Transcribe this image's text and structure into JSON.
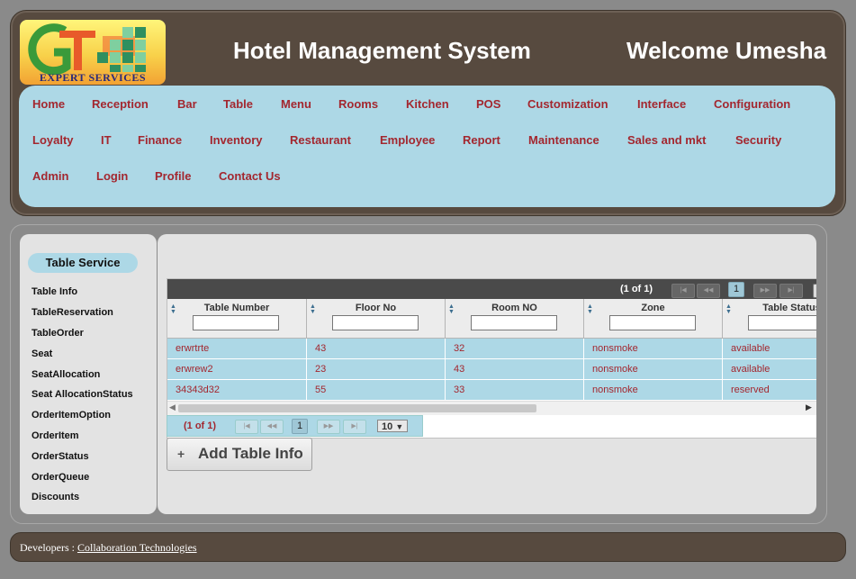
{
  "header": {
    "logo_text": "EXPERT SERVICES",
    "title": "Hotel Management System",
    "welcome": "Welcome Umesha"
  },
  "nav": {
    "items": [
      "Home",
      "Reception",
      "Bar",
      "Table",
      "Menu",
      "Rooms",
      "Kitchen",
      "POS",
      "Customization",
      "Interface",
      "Configuration",
      "Loyalty",
      "IT",
      "Finance",
      "Inventory",
      "Restaurant",
      "Employee",
      "Report",
      "Maintenance",
      "Sales and mkt",
      "Security",
      "Admin",
      "Login",
      "Profile",
      "Contact Us"
    ]
  },
  "sidebar": {
    "title": "Table Service",
    "items": [
      "Table Info",
      "TableReservation",
      "TableOrder",
      "Seat",
      "SeatAllocation",
      "Seat AllocationStatus",
      "OrderItemOption",
      "OrderItem",
      "OrderStatus",
      "OrderQueue",
      "Discounts"
    ]
  },
  "grid": {
    "page_info": "(1 of 1)",
    "current_page": "1",
    "columns": [
      "Table Number",
      "Floor No",
      "Room NO",
      "Zone",
      "Table Status"
    ],
    "rows": [
      [
        "erwrtrte",
        "43",
        "32",
        "nonsmoke",
        "available"
      ],
      [
        "erwrew2",
        "23",
        "43",
        "nonsmoke",
        "available"
      ],
      [
        "34343d32",
        "55",
        "33",
        "nonsmoke",
        "reserved"
      ]
    ],
    "rows_per_page": "10"
  },
  "actions": {
    "add_label": "Add Table Info",
    "add_icon": "+"
  },
  "footer": {
    "prefix": "Developers :",
    "link": "Collaboration Technologies"
  },
  "colors": {
    "header_bg": "#574a3f",
    "nav_bg": "#add8e6",
    "link_red": "#a3272f"
  }
}
